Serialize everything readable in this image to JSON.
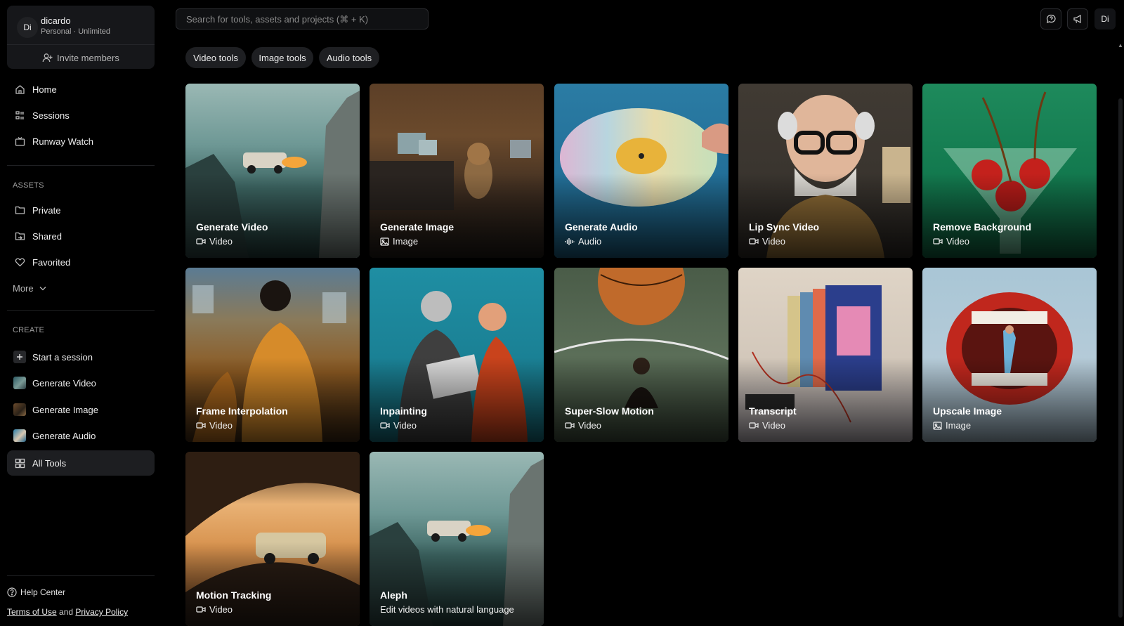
{
  "account": {
    "avatar": "Di",
    "name": "dicardo",
    "plan": "Personal · Unlimited",
    "invite_label": "Invite members"
  },
  "nav": {
    "home": "Home",
    "sessions": "Sessions",
    "watch": "Runway Watch"
  },
  "assets": {
    "heading": "ASSETS",
    "private": "Private",
    "shared": "Shared",
    "favorited": "Favorited",
    "more": "More"
  },
  "create": {
    "heading": "CREATE",
    "start_session": "Start a session",
    "generate_video": "Generate Video",
    "generate_image": "Generate Image",
    "generate_audio": "Generate Audio",
    "all_tools": "All Tools"
  },
  "footer": {
    "help": "Help Center",
    "terms": "Terms of Use",
    "and": "and",
    "privacy": "Privacy Policy"
  },
  "search": {
    "placeholder": "Search for tools, assets and projects (⌘ + K)"
  },
  "top_avatar": "Di",
  "filters": [
    "Video tools",
    "Image tools",
    "Audio tools"
  ],
  "cards": [
    {
      "title": "Generate Video",
      "type": "Video",
      "icon": "video-icon"
    },
    {
      "title": "Generate Image",
      "type": "Image",
      "icon": "image-icon"
    },
    {
      "title": "Generate Audio",
      "type": "Audio",
      "icon": "audio-icon"
    },
    {
      "title": "Lip Sync Video",
      "type": "Video",
      "icon": "video-icon"
    },
    {
      "title": "Remove Background",
      "type": "Video",
      "icon": "video-icon"
    },
    {
      "title": "Frame Interpolation",
      "type": "Video",
      "icon": "video-icon"
    },
    {
      "title": "Inpainting",
      "type": "Video",
      "icon": "video-icon"
    },
    {
      "title": "Super-Slow Motion",
      "type": "Video",
      "icon": "video-icon"
    },
    {
      "title": "Transcript",
      "type": "Video",
      "icon": "video-icon"
    },
    {
      "title": "Upscale Image",
      "type": "Image",
      "icon": "image-icon"
    },
    {
      "title": "Motion Tracking",
      "type": "Video",
      "icon": "video-icon"
    },
    {
      "title": "Aleph",
      "type": "Edit videos with natural language",
      "icon": ""
    }
  ],
  "colors": {
    "background": "#000000",
    "panel": "#16171a",
    "active_nav": "#1d1e21",
    "chip": "#1e1f22"
  }
}
